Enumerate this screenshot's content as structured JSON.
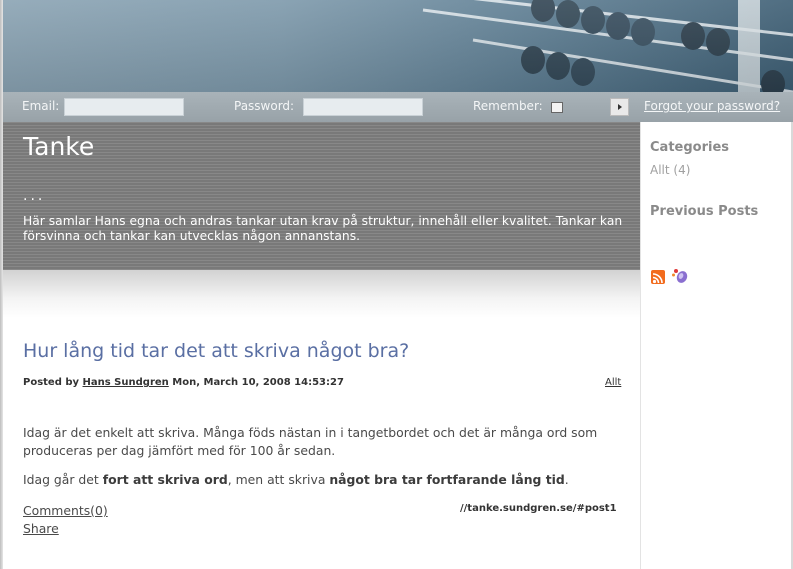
{
  "login": {
    "email_label": "Email:",
    "password_label": "Password:",
    "remember_label": "Remember:",
    "forgot_label": "Forgot your password?"
  },
  "header": {
    "title": "Tanke",
    "dots": "...",
    "description": "Här samlar Hans egna och andras tankar utan krav på struktur, innehåll eller kvalitet. Tankar kan försvinna och tankar kan utvecklas någon annanstans."
  },
  "sidebar": {
    "categories_heading": "Categories",
    "category_item": "Allt (4)",
    "previous_heading": "Previous Posts",
    "icons": [
      "rss-icon",
      "feed-icon"
    ]
  },
  "post": {
    "title": "Hur lång tid tar det att skriva något bra?",
    "posted_by": "Posted by",
    "author": "Hans Sundgren",
    "date": "Mon, March 10, 2008 14:53:27",
    "category": "Allt",
    "paragraph1": "Idag är det enkelt att skriva. Många föds nästan in i tangetbordet och det är många ord som produceras per dag jämfört med för 100 år sedan.",
    "p2_a": "Idag går det ",
    "p2_b": "fort att skriva ord",
    "p2_c": ", men att skriva ",
    "p2_d": "något bra tar fortfarande lång tid",
    "p2_e": ".",
    "comments": "Comments(0)",
    "permalink": "//tanke.sundgren.se/#post1",
    "share": "Share"
  },
  "colors": {
    "title_blue": "#5a6fa3",
    "rss_orange": "#f26b1d"
  }
}
